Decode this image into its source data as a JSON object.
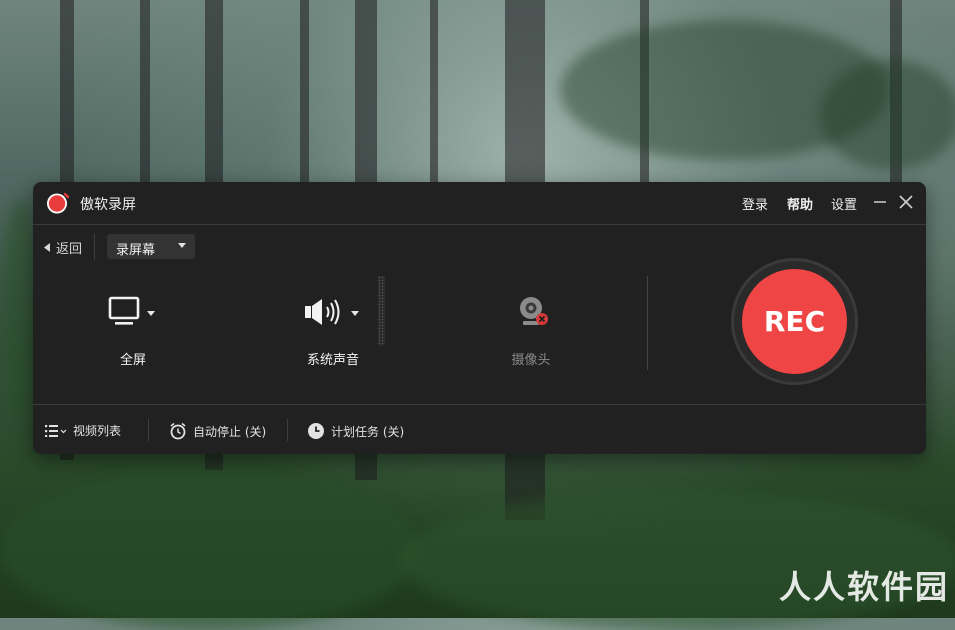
{
  "app": {
    "title": "傲软录屏",
    "menu": {
      "login": "登录",
      "help": "帮助",
      "settings": "设置"
    }
  },
  "toolbar": {
    "back_label": "返回",
    "mode_selected": "录屏幕"
  },
  "panels": {
    "screen": {
      "label": "全屏",
      "icon": "monitor-icon"
    },
    "audio": {
      "label": "系统声音",
      "icon": "speaker-icon"
    },
    "camera": {
      "label": "摄像头",
      "icon": "webcam-icon",
      "disabled": true
    }
  },
  "record_button": {
    "label": "REC",
    "color": "#ef4545"
  },
  "bottom": {
    "video_list": "视频列表",
    "auto_stop": "自动停止 (关)",
    "schedule": "计划任务 (关)"
  },
  "watermark": "人人软件园"
}
